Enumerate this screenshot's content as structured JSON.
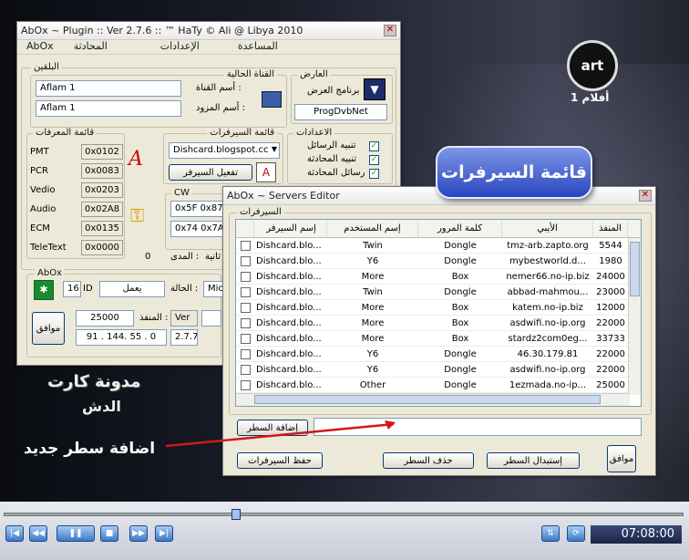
{
  "tv": {
    "channel_logo": "art",
    "channel_name": "أفلام 1"
  },
  "overlay": {
    "blog_line1": "مدونة كارت",
    "blog_line2": "الدش",
    "add_row_note": "اضافة سطر جديد",
    "callout": "قائمة السيرفرات"
  },
  "main": {
    "title": "AbOx ~ Plugin :: Ver 2.7.6 :: ™ HaTy © Ali @ Libya 2010",
    "menu": [
      "AbOx",
      "المحادثة",
      "الإعدادات",
      "المساعدة"
    ],
    "receiver_group": "البلقين",
    "current_channel_group": "القناة الحالية",
    "channel_name_label": "أسم القناة :",
    "channel_name_value": "Aflam 1",
    "provider_name_label": "أسم المزود :",
    "provider_name_value": "Aflam 1",
    "viewer_group": "العارض",
    "viewer_program_label": "برنامج العرض",
    "viewer_value": "ProgDvbNet",
    "ids_group": "قائمة المعرفات",
    "ids": [
      {
        "label": "PMT",
        "value": "0x0102"
      },
      {
        "label": "PCR",
        "value": "0x0083"
      },
      {
        "label": "Vedio",
        "value": "0x0203"
      },
      {
        "label": "Audio",
        "value": "0x02A8"
      },
      {
        "label": "ECM",
        "value": "0x0135"
      },
      {
        "label": "TeleText",
        "value": "0x0000"
      }
    ],
    "servers_group": "قائمة السيرفرات",
    "server_selected": "Dishcard.blogspot.cc",
    "activate_server": "تفعيل السيرفر",
    "settings_group": "الاعدادات",
    "settings": [
      "تنبيه الرسائل",
      "تنبيه المحادثة",
      "رسائل المحادثة"
    ],
    "cw_group": "CW",
    "cw1": "0x5F 0x87",
    "cw2": "0x74 0x7A",
    "range_label": "المدى :",
    "range_value": "0",
    "second_label": "ثانية",
    "abox_group": "AbOx",
    "id_value": "16",
    "id_label": "ID",
    "status_value": "يعمل",
    "status_label": "الحالة :",
    "mic_value": "Mic",
    "port_value": "25000",
    "port_label": "المنفذ :",
    "ver_label": "Ver",
    "ip_value": "91 . 144. 55 . 0",
    "version_value": "2.7.7",
    "ok": "موافق"
  },
  "editor": {
    "title": "AbOx ~ Servers Editor",
    "group": "السيرفرات",
    "columns": [
      "إسم السيرفر",
      "إسم المستخدم",
      "كلمة المرور",
      "الأيبي",
      "المنفذ"
    ],
    "rows": [
      [
        "Dishcard.blo...",
        "Twin",
        "Dongle",
        "tmz-arb.zapto.org",
        "5544"
      ],
      [
        "Dishcard.blo...",
        "Y6",
        "Dongle",
        "mybestworld.d...",
        "1980"
      ],
      [
        "Dishcard.blo...",
        "More",
        "Box",
        "nemer66.no-ip.biz",
        "24000"
      ],
      [
        "Dishcard.blo...",
        "Twin",
        "Dongle",
        "abbad-mahmou...",
        "23000"
      ],
      [
        "Dishcard.blo...",
        "More",
        "Box",
        "katem.no-ip.biz",
        "12000"
      ],
      [
        "Dishcard.blo...",
        "More",
        "Box",
        "asdwifi.no-ip.org",
        "22000"
      ],
      [
        "Dishcard.blo...",
        "More",
        "Box",
        "stardz2com0eg...",
        "33733"
      ],
      [
        "Dishcard.blo...",
        "Y6",
        "Dongle",
        "46.30.179.81",
        "22000"
      ],
      [
        "Dishcard.blo...",
        "Y6",
        "Dongle",
        "asdwifi.no-ip.org",
        "22000"
      ],
      [
        "Dishcard.blo...",
        "Other",
        "Dongle",
        "1ezmada.no-ip...",
        "25000"
      ]
    ],
    "add_row": "إضافة السطر",
    "save": "حفظ السيرفرات",
    "delete_row": "حذف السطر",
    "replace_row": "إستبدال السطر",
    "ok": "موافق"
  },
  "player": {
    "time": "07:08:00"
  }
}
